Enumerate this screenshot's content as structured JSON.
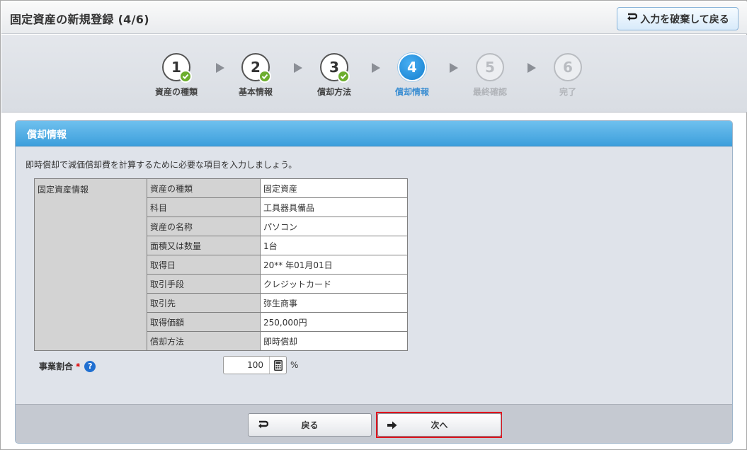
{
  "header": {
    "title": "固定資産の新規登録 (4/6)",
    "discard_label": "入力を破棄して戻る"
  },
  "stepper": {
    "steps": [
      {
        "num": "1",
        "label": "資産の種類",
        "state": "done"
      },
      {
        "num": "2",
        "label": "基本情報",
        "state": "done"
      },
      {
        "num": "3",
        "label": "償却方法",
        "state": "done"
      },
      {
        "num": "4",
        "label": "償却情報",
        "state": "active"
      },
      {
        "num": "5",
        "label": "最終確認",
        "state": "future"
      },
      {
        "num": "6",
        "label": "完了",
        "state": "future"
      }
    ]
  },
  "panel": {
    "title": "償却情報",
    "description": "即時償却で減価償却費を計算するために必要な項目を入力しましょう。",
    "group_label": "固定資産情報",
    "rows": [
      {
        "key": "資産の種類",
        "value": "固定資産"
      },
      {
        "key": "科目",
        "value": "工具器具備品"
      },
      {
        "key": "資産の名称",
        "value": "パソコン"
      },
      {
        "key": "面積又は数量",
        "value": "1台"
      },
      {
        "key": "取得日",
        "value": "20** 年01月01日"
      },
      {
        "key": "取引手段",
        "value": "クレジットカード"
      },
      {
        "key": "取引先",
        "value": "弥生商事"
      },
      {
        "key": "取得価額",
        "value": "250,000円"
      },
      {
        "key": "償却方法",
        "value": "即時償却"
      }
    ],
    "business_ratio": {
      "label": "事業割合",
      "required_mark": "*",
      "help": "?",
      "value": "100",
      "unit": "%"
    }
  },
  "footer": {
    "back_label": "戻る",
    "next_label": "次へ"
  },
  "colors": {
    "accent": "#3d9fdc",
    "active_step": "#2a93e0",
    "check": "#6cad2d",
    "highlight": "#e0141d"
  }
}
